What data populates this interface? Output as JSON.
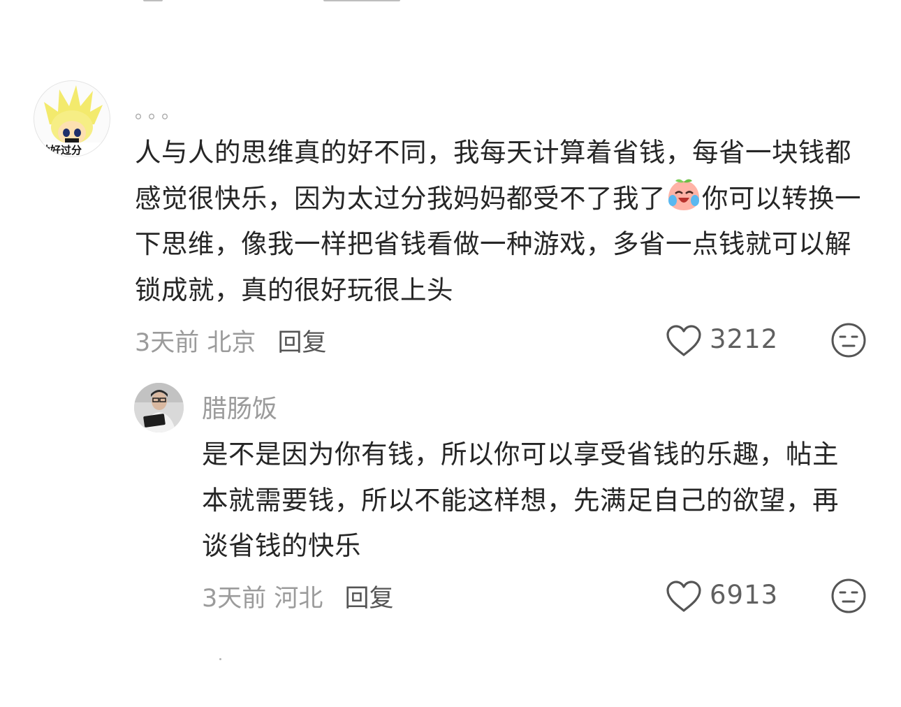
{
  "comment": {
    "username": "。。。",
    "avatar_caption": "呐好过分",
    "text_before_emoji": "人与人的思维真的好不同，我每天计算着省钱，每省一块钱都感觉很快乐，因为太过分我妈妈都受不了我了",
    "text_after_emoji": "你可以转换一下思维，像我一样把省钱看做一种游戏，多省一点钱就可以解锁成就，真的很好玩很上头",
    "time": "3天前",
    "location": "北京",
    "reply_label": "回复",
    "like_count": "3212"
  },
  "reply": {
    "username": "腊肠饭",
    "text": "是不是因为你有钱，所以你可以享受省钱的乐趣，帖主本就需要钱，所以不能这样想，先满足自己的欲望，再谈省钱的快乐",
    "time": "3天前",
    "location": "河北",
    "reply_label": "回复",
    "like_count": "6913"
  },
  "icons": {
    "like": "heart-outline-icon",
    "dislike": "meh-face-icon",
    "emoji": "crying-laughing-peach-emoji"
  }
}
